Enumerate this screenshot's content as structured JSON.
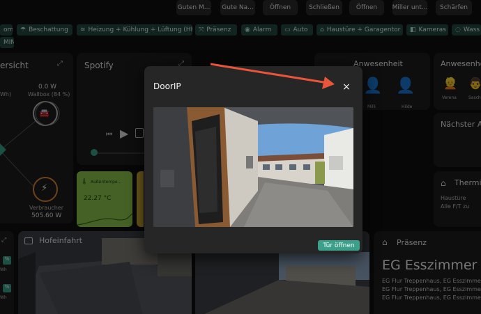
{
  "top_buttons": [
    {
      "label": "Guten M..."
    },
    {
      "label": "Gute Na..."
    },
    {
      "label": "Öffnen"
    },
    {
      "label": "Schließen"
    },
    {
      "label": "Öffnen"
    },
    {
      "label": "Miller unt..."
    },
    {
      "label": "Schärfen"
    }
  ],
  "nav_pills": [
    {
      "label": "om",
      "icon": ""
    },
    {
      "label": "Beschattung",
      "icon": "sunshade-icon"
    },
    {
      "label": "Heizung + Kühlung + Lüftung (HKL)",
      "icon": "hvac-icon"
    },
    {
      "label": "Präsenz",
      "icon": "presence-icon"
    },
    {
      "label": "Alarm",
      "icon": "alarm-icon"
    },
    {
      "label": "Auto",
      "icon": "car-icon"
    },
    {
      "label": "Haustüre + Garagentor",
      "icon": "garage-icon"
    },
    {
      "label": "Kameras",
      "icon": "camera-icon"
    },
    {
      "label": "Wass",
      "icon": "water-icon"
    }
  ],
  "nav_row2": {
    "label": "MIN"
  },
  "energy_card": {
    "title": "ersicht",
    "wh": "Wh)",
    "wallbox_value": "0.0 W",
    "wallbox_label": "Wallbox (84 %)",
    "consumer_label": "Verbraucher",
    "consumer_value": "505.60 W"
  },
  "spotify_card": {
    "title": "Spotify"
  },
  "temp_tile": {
    "label": "Außentempe...",
    "value": "22.27 °C"
  },
  "anwesenheit1": {
    "title": "Anwesenheit",
    "people": [
      {
        "name": "Milli"
      },
      {
        "name": "Hilde"
      }
    ]
  },
  "anwesenheit2": {
    "title": "Anwesenhe",
    "people": [
      {
        "name": "Verena"
      },
      {
        "name": "Sasch"
      }
    ]
  },
  "next_card": {
    "title": "Nächster Ab"
  },
  "thermo_card": {
    "title": "Thermis",
    "line1": "Haustüre",
    "line2": "Alle F/T zu"
  },
  "left_small": {
    "items": [
      {
        "badge": "%",
        "text": "Wh"
      },
      {
        "badge": "%",
        "text": "Wh"
      }
    ]
  },
  "hofeinfahrt": {
    "title": "Hofeinfahrt"
  },
  "praesenz_card": {
    "title": "Präsenz",
    "big": "EG Esszimmer",
    "lines": [
      "EG Flur Treppenhaus, EG Esszimmer,",
      "EG Flur Treppenhaus, EG Esszimmer,",
      "EG Flur Treppenhaus, EG Esszimmer,"
    ]
  },
  "modal": {
    "title": "DoorIP",
    "close_label": "×",
    "open_button": "Tür öffnen"
  },
  "colors": {
    "accent": "#3aa08a",
    "pill_bg": "#24483f",
    "arrow": "#e8553a"
  }
}
